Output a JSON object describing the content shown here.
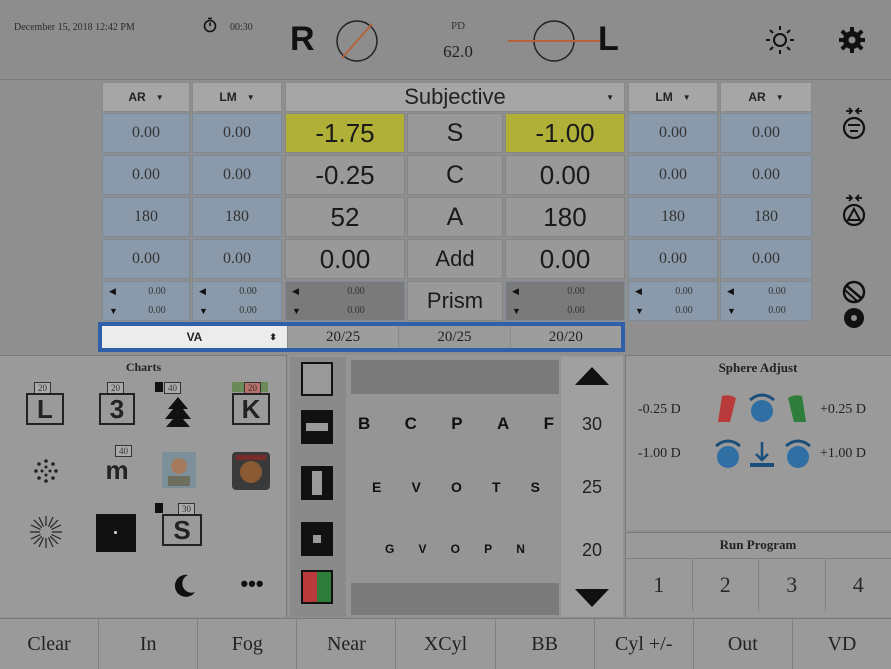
{
  "topbar": {
    "datetime": "December 15, 2018  12:42 PM",
    "timer": "00:30",
    "right_eye": "R",
    "left_eye": "L",
    "pd_label": "PD",
    "pd_value": "62.0",
    "brightness_icon": "sun-icon",
    "settings_icon": "gear-icon"
  },
  "table": {
    "headers": {
      "left_ar": "AR",
      "left_lm": "LM",
      "subjective": "Subjective",
      "right_lm": "LM",
      "right_ar": "AR"
    },
    "rows": [
      {
        "label": "S",
        "l_ar": "0.00",
        "l_lm": "0.00",
        "r_val": "-1.75",
        "l_val": "-1.00",
        "r_lm": "0.00",
        "r_ar": "0.00"
      },
      {
        "label": "C",
        "l_ar": "0.00",
        "l_lm": "0.00",
        "r_val": "-0.25",
        "l_val": "0.00",
        "r_lm": "0.00",
        "r_ar": "0.00"
      },
      {
        "label": "A",
        "l_ar": "180",
        "l_lm": "180",
        "r_val": "52",
        "l_val": "180",
        "r_lm": "180",
        "r_ar": "180"
      },
      {
        "label": "Add",
        "l_ar": "0.00",
        "l_lm": "0.00",
        "r_val": "0.00",
        "l_val": "0.00",
        "r_lm": "0.00",
        "r_ar": "0.00"
      }
    ],
    "prism": {
      "label": "Prism",
      "values": [
        "0.00",
        "0.00"
      ]
    }
  },
  "va": {
    "selector": "VA",
    "values": [
      "20/25",
      "20/25",
      "20/20"
    ]
  },
  "charts": {
    "title": "Charts",
    "badges": [
      "20",
      "20",
      "40",
      "20",
      "40",
      "30"
    ],
    "tiles": [
      "L",
      "3",
      "K",
      "m",
      "S"
    ]
  },
  "optotypes": {
    "rows": [
      {
        "letters": [
          "B",
          "C",
          "P",
          "A",
          "F"
        ],
        "va": "30"
      },
      {
        "letters": [
          "E",
          "V",
          "O",
          "T",
          "S"
        ],
        "va": "25"
      },
      {
        "letters": [
          "G",
          "V",
          "O",
          "P",
          "N"
        ],
        "va": "20"
      }
    ]
  },
  "sphere_adjust": {
    "title": "Sphere Adjust",
    "minus_small": "-0.25 D",
    "plus_small": "+0.25 D",
    "minus_big": "-1.00 D",
    "plus_big": "+1.00 D"
  },
  "run_program": {
    "title": "Run Program",
    "buttons": [
      "1",
      "2",
      "3",
      "4"
    ]
  },
  "bottom": {
    "buttons": [
      "Clear",
      "In",
      "Fog",
      "Near",
      "XCyl",
      "BB",
      "Cyl +/-",
      "Out",
      "VD"
    ]
  },
  "colors": {
    "highlight_yellow": "#b0b038",
    "lensometer_blue": "#8a9aab",
    "selection_blue": "#2f5fa8",
    "red": "#b93a3a",
    "green": "#2e7d3a"
  }
}
